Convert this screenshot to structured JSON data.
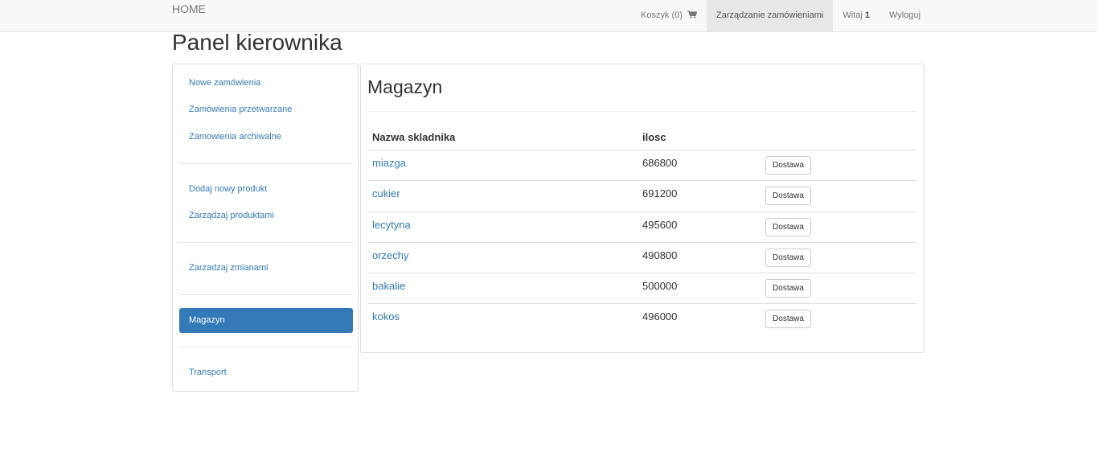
{
  "navbar": {
    "brand": "HOME",
    "cart_label": "Koszyk (0)",
    "cart_icon": "shopping-cart-icon",
    "manage_orders_label": "Zarządzanie zamówieniami",
    "greeting_label": "Witaj",
    "user_name": "1",
    "logout_label": "Wyloguj"
  },
  "page": {
    "title": "Panel kierownika"
  },
  "sidebar": {
    "items": [
      {
        "label": "Nowe zamówienia",
        "active": false
      },
      {
        "label": "Zamówienia przetwarzane",
        "active": false
      },
      {
        "label": "Zamowienia archiwalne",
        "active": false
      },
      {
        "label": "Dodaj nowy produkt",
        "active": false
      },
      {
        "label": "Zarządzaj produktami",
        "active": false
      },
      {
        "label": "Zarzadzaj zmianami",
        "active": false
      },
      {
        "label": "Magazyn",
        "active": true
      },
      {
        "label": "Transport",
        "active": false
      }
    ]
  },
  "warehouse": {
    "title": "Magazyn",
    "columns": [
      "Nazwa skladnika",
      "ilosc"
    ],
    "button_label": "Dostawa",
    "rows": [
      {
        "name": "miazga",
        "qty": "686800"
      },
      {
        "name": "cukier",
        "qty": "691200"
      },
      {
        "name": "lecytyna",
        "qty": "495600"
      },
      {
        "name": "orzechy",
        "qty": "490800"
      },
      {
        "name": "bakalie",
        "qty": "500000"
      },
      {
        "name": "kokos",
        "qty": "496000"
      }
    ]
  },
  "colors": {
    "link": "#337ab7",
    "active_bg": "#337ab7",
    "navbar_bg": "#f8f8f8"
  }
}
